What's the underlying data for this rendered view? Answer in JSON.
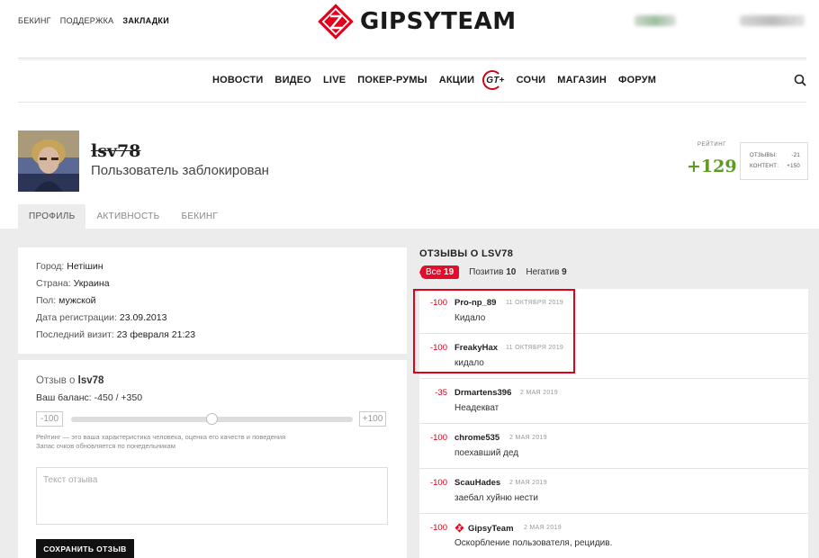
{
  "top_links": [
    {
      "label": "Бекинг",
      "active": false
    },
    {
      "label": "Поддержка",
      "active": false
    },
    {
      "label": "Закладки",
      "active": true
    }
  ],
  "brand": {
    "name": "GIPSYTEAM",
    "accent": "#e2001a"
  },
  "main_nav": [
    "НОВОСТИ",
    "ВИДЕО",
    "LIVE",
    "ПОКЕР-РУМЫ",
    "АКЦИИ",
    "GT+",
    "СОЧИ",
    "МАГАЗИН",
    "ФОРУМ"
  ],
  "profile": {
    "username": "lsv78",
    "status": "Пользователь заблокирован",
    "rating_label": "Рейтинг",
    "rating": "+129",
    "rating_color": "#5c9a22",
    "reviews_label": "Отзывы:",
    "reviews_value": "-21",
    "content_label": "Контент:",
    "content_value": "+150"
  },
  "tabs": [
    "Профиль",
    "Активность",
    "Бекинг"
  ],
  "info": {
    "city_label": "Город:",
    "city": "Нетішин",
    "country_label": "Страна:",
    "country": "Украина",
    "gender_label": "Пол:",
    "gender": "мужской",
    "reg_label": "Дата регистрации:",
    "reg": "23.09.2013",
    "visit_label": "Последний визит:",
    "visit": "23 февраля 21:23"
  },
  "review_form": {
    "title_prefix": "Отзыв о",
    "title_user": "lsv78",
    "balance": "Ваш баланс: -450 / +350",
    "min": "-100",
    "max": "+100",
    "slider_value": 0,
    "hint_line1": "Рейтинг — это ваша характеристика человека, оценка его качеств и поведения",
    "hint_line2": "Запас очков обновляется по понедельникам",
    "placeholder": "Текст отзыва",
    "save_label": "Сохранить отзыв"
  },
  "reviews_section": {
    "heading": "Отзывы о lsv78",
    "filters": {
      "all_label": "Все",
      "all_count": "19",
      "pos_label": "Позитив",
      "pos_count": "10",
      "neg_label": "Негатив",
      "neg_count": "9"
    },
    "items": [
      {
        "score": "-100",
        "author": "Pro-np_89",
        "date": "11 октября 2019",
        "text": "Кидало"
      },
      {
        "score": "-100",
        "author": "FreakyHax",
        "date": "11 октября 2019",
        "text": "кидало"
      },
      {
        "score": "-35",
        "author": "Drmartens396",
        "date": "2 мая 2019",
        "text": "Неадекват"
      },
      {
        "score": "-100",
        "author": "chrome535",
        "date": "2 мая 2019",
        "text": "поехавший дед"
      },
      {
        "score": "-100",
        "author": "ScauHades",
        "date": "2 мая 2019",
        "text": "заебал хуйню нести"
      },
      {
        "score": "-100",
        "author": "GipsyTeam",
        "date": "2 мая 2019",
        "text": "Оскорбление пользователя, рецидив."
      }
    ]
  }
}
